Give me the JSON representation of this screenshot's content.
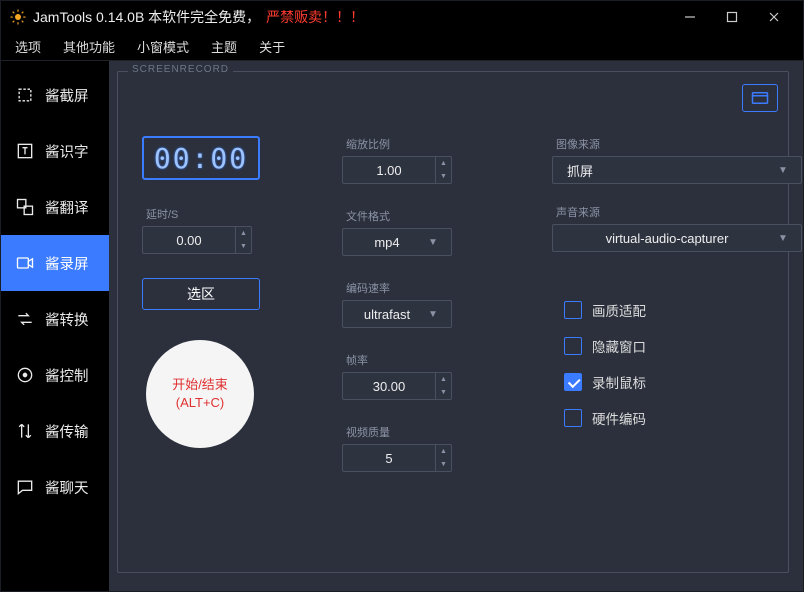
{
  "title": "JamTools 0.14.0B  本软件完全免费，",
  "title_warn": "严禁贩卖！！！",
  "menu": [
    "选项",
    "其他功能",
    "小窗模式",
    "主题",
    "关于"
  ],
  "sidebar": {
    "items": [
      {
        "label": "酱截屏",
        "icon": "crop"
      },
      {
        "label": "酱识字",
        "icon": "text"
      },
      {
        "label": "酱翻译",
        "icon": "translate"
      },
      {
        "label": "酱录屏",
        "icon": "record"
      },
      {
        "label": "酱转换",
        "icon": "convert"
      },
      {
        "label": "酱控制",
        "icon": "control"
      },
      {
        "label": "酱传输",
        "icon": "transfer"
      },
      {
        "label": "酱聊天",
        "icon": "chat"
      }
    ],
    "active": 3
  },
  "panel": {
    "title": "SCREENRECORD",
    "timer": "00:00",
    "delay": {
      "label": "延时/S",
      "value": "0.00"
    },
    "select_region": "选区",
    "record_line1": "开始/结束",
    "record_line2": "(ALT+C)",
    "scale": {
      "label": "缩放比例",
      "value": "1.00"
    },
    "format": {
      "label": "文件格式",
      "value": "mp4"
    },
    "preset": {
      "label": "编码速率",
      "value": "ultrafast"
    },
    "fps": {
      "label": "帧率",
      "value": "30.00"
    },
    "quality": {
      "label": "视频质量",
      "value": "5"
    },
    "video_source": {
      "label": "图像来源",
      "value": "抓屏"
    },
    "audio_source": {
      "label": "声音来源",
      "value": "virtual-audio-capturer"
    },
    "checks": [
      {
        "label": "画质适配",
        "checked": false
      },
      {
        "label": "隐藏窗口",
        "checked": false
      },
      {
        "label": "录制鼠标",
        "checked": true
      },
      {
        "label": "硬件编码",
        "checked": false
      }
    ]
  }
}
